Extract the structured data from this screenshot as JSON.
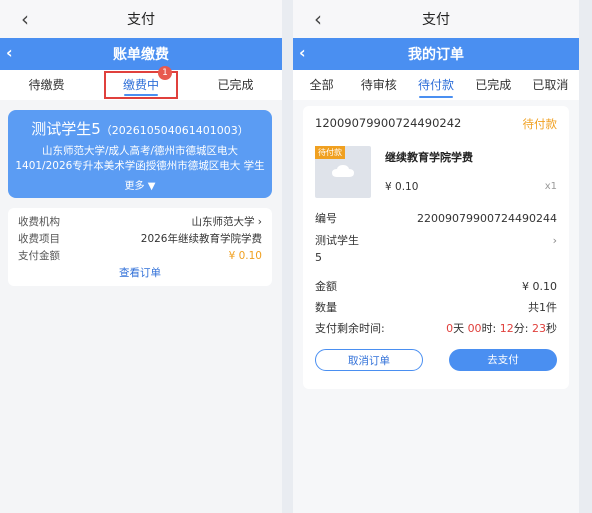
{
  "left": {
    "topbar_title": "支付",
    "back_icon": "‹",
    "bluebar_title": "账单缴费",
    "tabs": [
      "待缴费",
      "缴费中",
      "已完成"
    ],
    "tab_badge": "1",
    "student_name": "测试学生5",
    "student_id": "（202610504061401003）",
    "desc_line1": "山东师范大学/成人高考/德州市德城区电大",
    "desc_line2": "1401/2026专升本美术学函授德州市德城区电大 学生",
    "more_label": "更多",
    "rows": [
      {
        "label": "收费机构",
        "value": "山东师范大学"
      },
      {
        "label": "收费项目",
        "value": "2026年继续教育学院学费"
      },
      {
        "label": "支付金额",
        "value": "¥ 0.10"
      }
    ],
    "view_order": "查看订单"
  },
  "right": {
    "topbar_title": "支付",
    "bluebar_title": "我的订单",
    "tabs": [
      "全部",
      "待审核",
      "待付款",
      "已完成",
      "已取消"
    ],
    "order_no": "12009079900724490242",
    "order_status": "待付款",
    "product_tag": "待付款",
    "product_name": "继续教育学院学费",
    "product_price": "¥ 0.10",
    "product_qty": "x1",
    "serial_label": "编号",
    "serial_value": "22009079900724490244",
    "student_line1": "测试学生",
    "student_line2": "5",
    "amount_label": "金额",
    "amount_value": "¥ 0.10",
    "qty_label": "数量",
    "qty_value": "共1件",
    "remain_label": "支付剩余时间:",
    "countdown": {
      "d": "0",
      "d_unit": "天",
      "h": "00",
      "h_unit": "时:",
      "m": "12",
      "m_unit": "分:",
      "s": "23",
      "s_unit": "秒"
    },
    "cancel_label": "取消订单",
    "pay_label": "去支付"
  },
  "colors": {
    "accent": "#4a8ff1",
    "price": "#f0a020",
    "alert": "#e0403c"
  }
}
